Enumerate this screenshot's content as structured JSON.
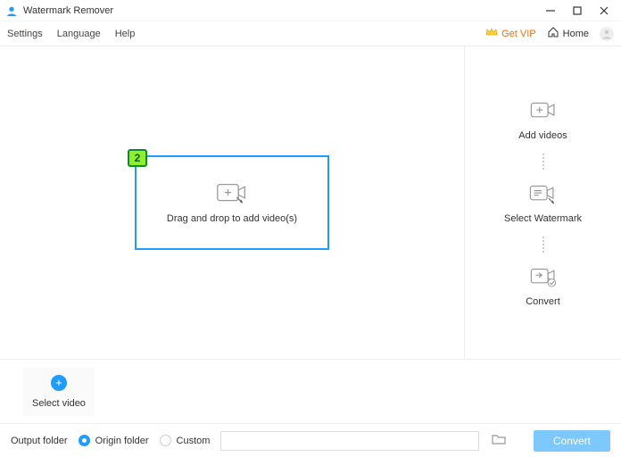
{
  "titlebar": {
    "title": "Watermark Remover"
  },
  "menu": {
    "settings": "Settings",
    "language": "Language",
    "help": "Help",
    "get_vip": "Get VIP",
    "home": "Home"
  },
  "dropzone": {
    "text": "Drag and drop to add video(s)",
    "badge": "2"
  },
  "steps": {
    "add": "Add videos",
    "select": "Select Watermark",
    "convert": "Convert"
  },
  "selectbar": {
    "label": "Select video"
  },
  "footer": {
    "label": "Output folder",
    "origin": "Origin folder",
    "custom": "Custom",
    "convert_btn": "Convert",
    "path": ""
  }
}
